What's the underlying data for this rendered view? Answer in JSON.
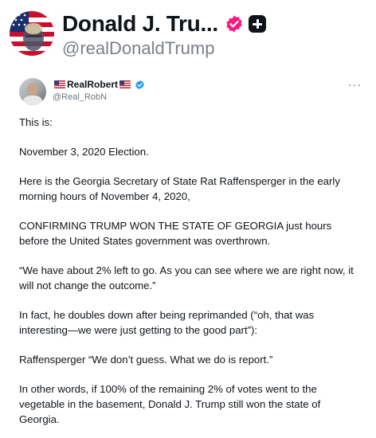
{
  "header": {
    "display_name": "Donald J. Tru...",
    "handle": "@realDonaldTrump",
    "avatar_icon": "flag-portrait-avatar",
    "verified_color": "#f91880"
  },
  "tweet": {
    "author_name": "RealRobert",
    "handle": "@Real_RobN",
    "more_label": "···",
    "verified_color": "#1d9bf0",
    "paragraphs": [
      "This is:",
      "November 3, 2020 Election.",
      "Here is the Georgia Secretary of State Rat Raffensperger in the early morning hours of November 4, 2020,",
      "CONFIRMING TRUMP WON THE STATE OF GEORGIA just hours before the United States government was overthrown.",
      "“We have about 2% left to go. As you can see where we are right now, it will not change the outcome.”",
      "In fact, he doubles down after being reprimanded (“oh, that was interesting—we were just getting to the good part”):",
      "Raffensperger “We don’t guess. What we do is report.”",
      "In other words, if 100% of the remaining 2% of votes went to the vegetable in the basement, Donald J. Trump still won the state of Georgia."
    ]
  }
}
